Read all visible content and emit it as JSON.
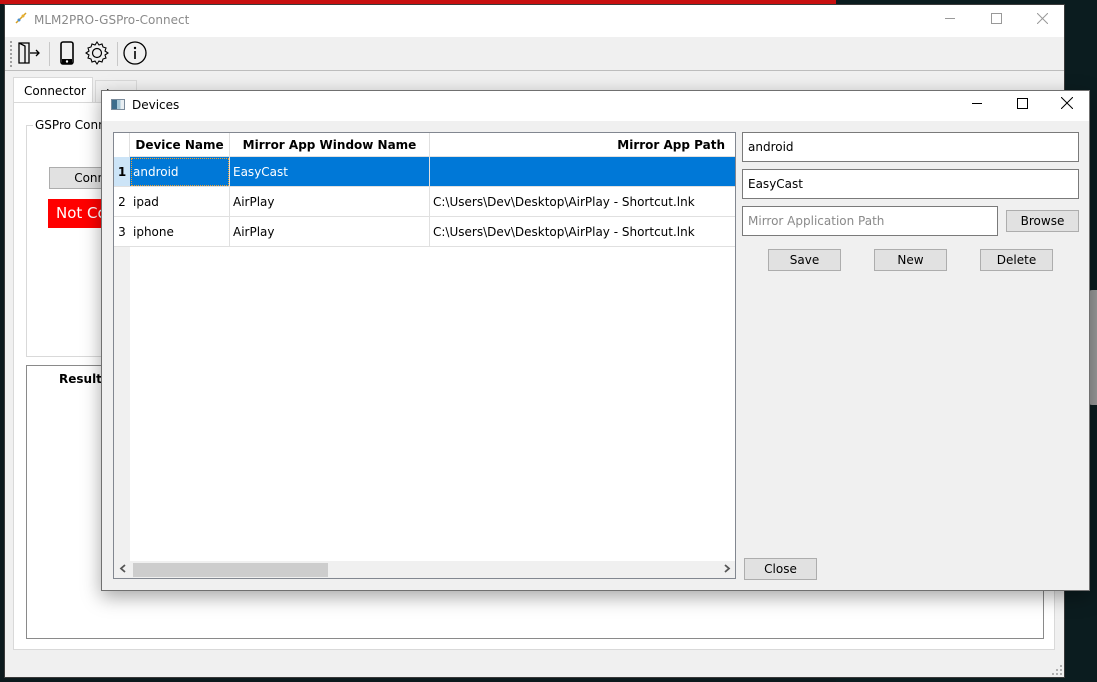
{
  "main_window": {
    "title": "MLM2PRO-GSPro-Connect",
    "controls": {
      "minimize": "—",
      "maximize": "☐",
      "close": "✕"
    },
    "toolbar": [
      {
        "name": "exit-icon",
        "label": "Exit"
      },
      {
        "name": "device-phone-icon",
        "label": "Devices"
      },
      {
        "name": "gear-icon",
        "label": "Settings"
      },
      {
        "name": "info-icon",
        "label": "About"
      }
    ],
    "tabs": [
      {
        "label": "Connector",
        "active": true
      },
      {
        "label": "L",
        "active": false
      }
    ],
    "connector": {
      "group_title": "GSPro Connector",
      "connect_button": "Connect",
      "status": "Not Connected",
      "status_color": "#ff0000",
      "result_title": "Result"
    }
  },
  "dialog": {
    "title": "Devices",
    "controls": {
      "minimize": "—",
      "maximize": "☐",
      "close": "✕"
    },
    "table": {
      "columns": [
        "Device Name",
        "Mirror App Window Name",
        "Mirror App Path"
      ],
      "rows": [
        {
          "index": "1",
          "device_name": "android",
          "window_name": "EasyCast",
          "path": "",
          "selected": true
        },
        {
          "index": "2",
          "device_name": "ipad",
          "window_name": "AirPlay",
          "path": "C:\\Users\\Dev\\Desktop\\AirPlay - Shortcut.lnk",
          "selected": false
        },
        {
          "index": "3",
          "device_name": "iphone",
          "window_name": "AirPlay",
          "path": "C:\\Users\\Dev\\Desktop\\AirPlay - Shortcut.lnk",
          "selected": false
        }
      ],
      "selection_color": "#0078d7"
    },
    "form": {
      "device_name_value": "android",
      "window_name_value": "EasyCast",
      "path_value": "",
      "path_placeholder": "Mirror Application Path",
      "browse_button": "Browse",
      "save_button": "Save",
      "new_button": "New",
      "delete_button": "Delete",
      "close_button": "Close"
    },
    "scroll": {
      "left_arrow": "<",
      "right_arrow": ">"
    }
  }
}
